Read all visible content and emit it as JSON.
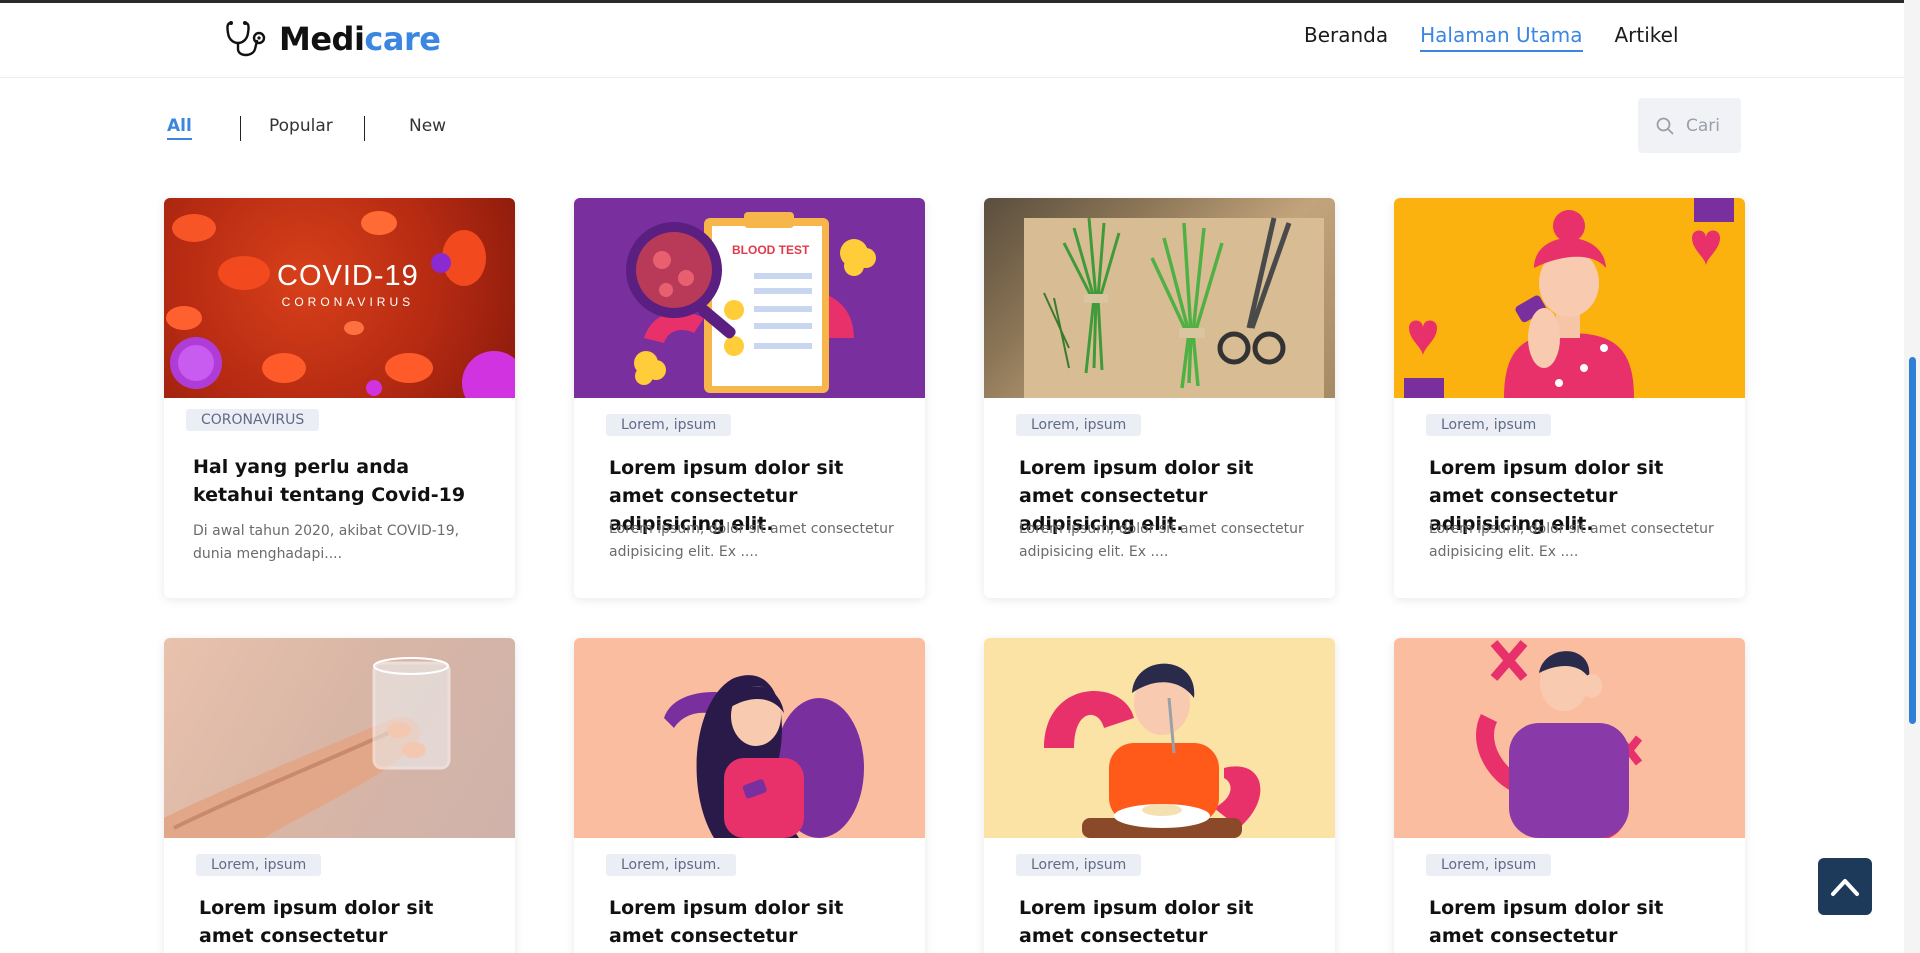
{
  "brand": {
    "part1": "Medi",
    "part2": "care"
  },
  "nav": {
    "items": [
      {
        "label": "Beranda"
      },
      {
        "label": "Halaman Utama"
      },
      {
        "label": "Artikel"
      }
    ]
  },
  "filters": {
    "all": "All",
    "popular": "Popular",
    "new": "New"
  },
  "search": {
    "placeholder": "Cari"
  },
  "cards": [
    {
      "image": "covid-19-coronavirus-banner",
      "image_title": "COVID-19",
      "image_subtitle": "CORONAVIRUS",
      "tag": "CORONAVIRUS",
      "title": "Hal yang perlu anda ketahui tentang Covid-19",
      "desc": "Di awal tahun 2020, akibat COVID-19, dunia menghadapi...."
    },
    {
      "image": "blood-test-clipboard-illustration",
      "image_title": "BLOOD TEST",
      "tag": "Lorem, ipsum",
      "title": "Lorem ipsum dolor sit amet consectetur adipisicing elit.",
      "desc": "Lorem ipsum, dolor sit amet consectetur adipisicing elit. Ex ...."
    },
    {
      "image": "wheatgrass-scissors-photo",
      "tag": "Lorem, ipsum",
      "title": "Lorem ipsum dolor sit amet consectetur adipisicing elit.",
      "desc": "Lorem ipsum, dolor sit amet consectetur adipisicing elit. Ex ...."
    },
    {
      "image": "woman-with-medicine-illustration",
      "tag": "Lorem, ipsum",
      "title": "Lorem ipsum dolor sit amet consectetur adipisicing elit.",
      "desc": "Lorem ipsum, dolor sit amet consectetur adipisicing elit. Ex ...."
    },
    {
      "image": "hand-holding-glass-photo",
      "tag": "Lorem, ipsum",
      "title": "Lorem ipsum dolor sit amet consectetur adipisicing elit."
    },
    {
      "image": "woman-long-hair-illustration",
      "tag": "Lorem, ipsum.",
      "title": "Lorem ipsum dolor sit amet consectetur adipisicing elit."
    },
    {
      "image": "man-eating-illustration",
      "tag": "Lorem, ipsum",
      "title": "Lorem ipsum dolor sit amet consectetur adipisicing elit."
    },
    {
      "image": "man-in-pain-illustration",
      "tag": "Lorem, ipsum",
      "title": "Lorem ipsum dolor sit amet consectetur adipisicing elit."
    }
  ],
  "colors": {
    "accent": "#3a86e0",
    "dark_button": "#1e3a5a",
    "tag_bg": "#eceef5"
  }
}
